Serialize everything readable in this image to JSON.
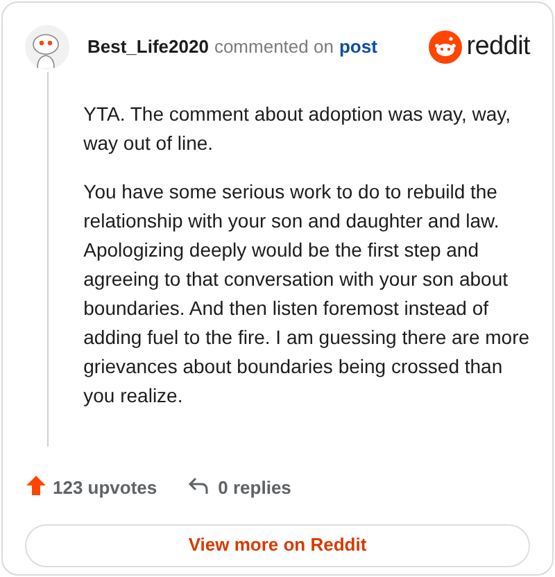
{
  "comment": {
    "author": "Best_Life2020",
    "action": "commented on",
    "target": "post",
    "brand": "reddit",
    "paragraphs": [
      "YTA. The comment about adoption was way, way, way out of line.",
      "You have some serious work to do to rebuild the relationship with your son and daughter and law. Apologizing deeply would be the first step and agreeing to that conversation with your son about boundaries. And then listen foremost instead of adding fuel to the fire. I am guessing there are more grievances about boundaries being crossed than you realize."
    ],
    "upvotes": "123 upvotes",
    "replies": "0 replies"
  },
  "button": "View more on Reddit"
}
